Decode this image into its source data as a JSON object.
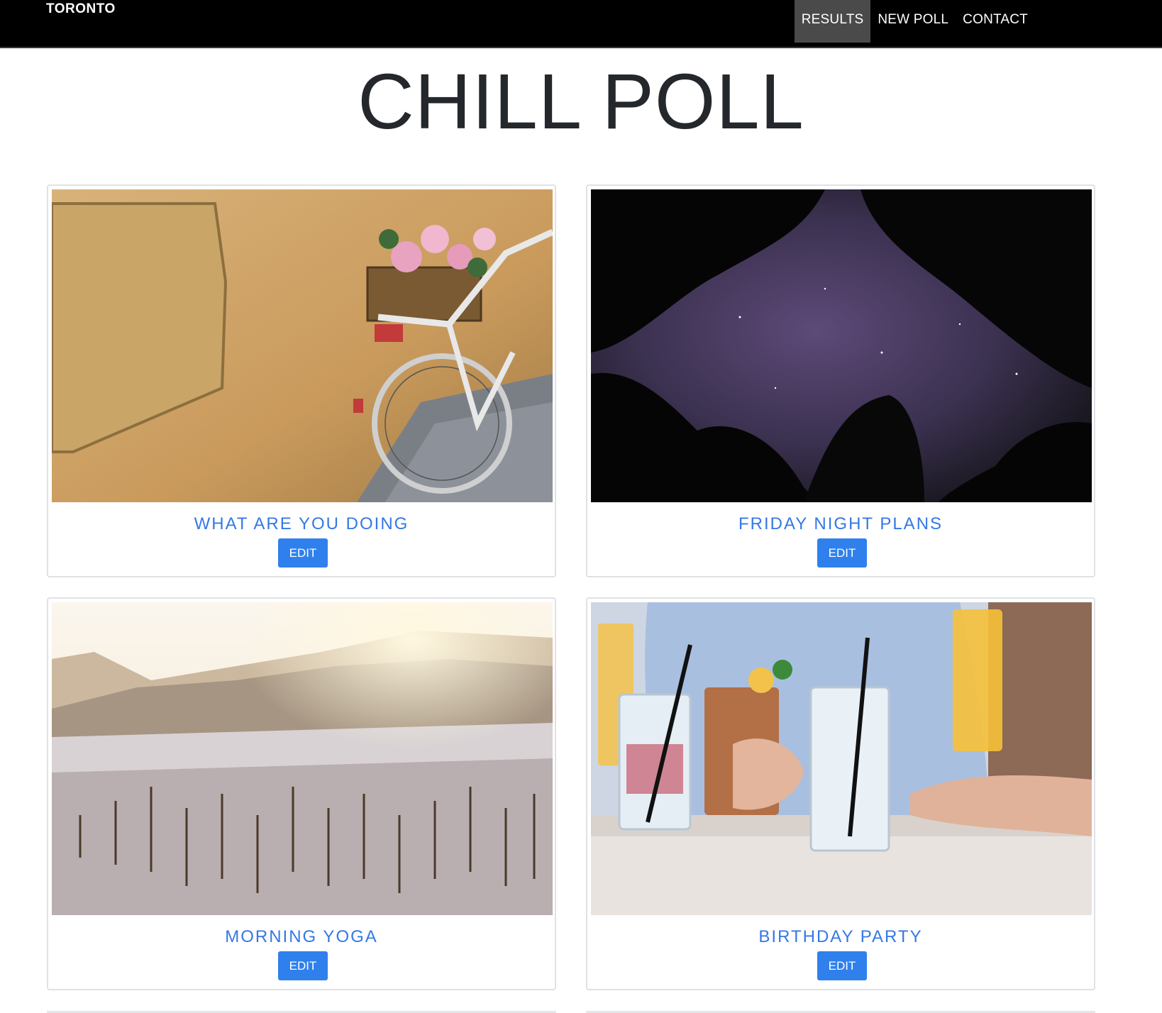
{
  "navbar": {
    "brand": "TORONTO",
    "items": [
      {
        "label": "RESULTS",
        "active": true
      },
      {
        "label": "NEW POLL",
        "active": false
      },
      {
        "label": "CONTACT",
        "active": false
      }
    ]
  },
  "page_title": "CHILL POLL",
  "polls": [
    {
      "title": "WHAT ARE YOU DOING",
      "edit_label": "EDIT",
      "image": "bicycle-with-flower-box-photo"
    },
    {
      "title": "FRIDAY NIGHT PLANS",
      "edit_label": "EDIT",
      "image": "night-sky-through-trees-photo"
    },
    {
      "title": "MORNING YOGA",
      "edit_label": "EDIT",
      "image": "snowy-mountain-forest-photo"
    },
    {
      "title": "BIRTHDAY PARTY",
      "edit_label": "EDIT",
      "image": "cocktail-drinks-photo"
    }
  ],
  "colors": {
    "accent": "#3478e5",
    "button": "#2f80ed",
    "navbar": "#000000",
    "nav_active": "#4a4a4a"
  }
}
